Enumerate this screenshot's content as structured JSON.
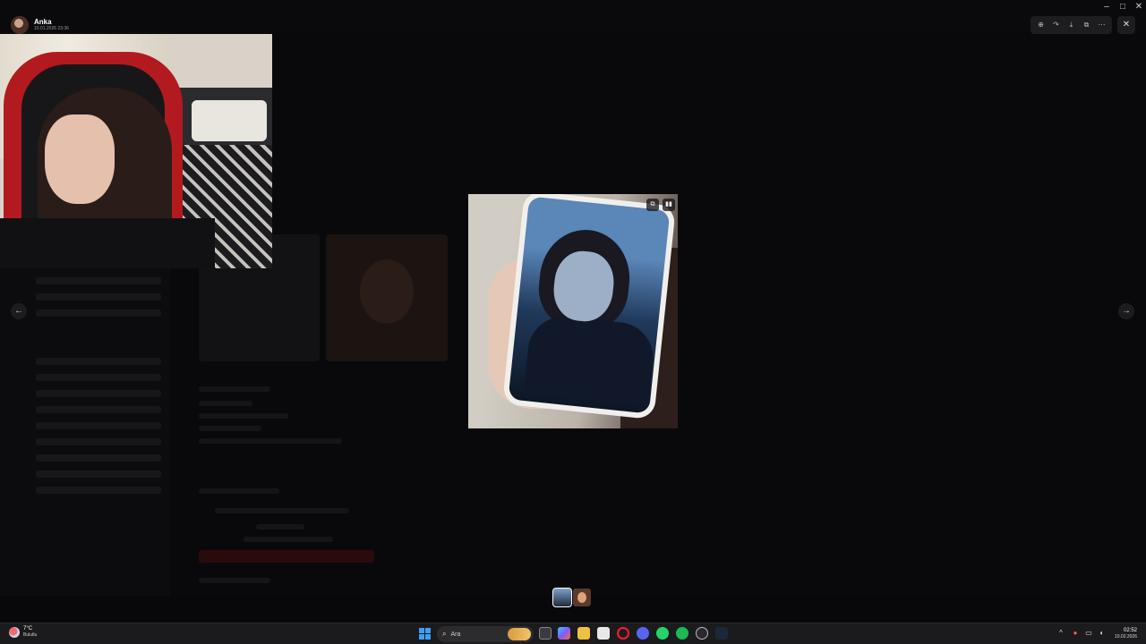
{
  "uploader": {
    "name": "Anka",
    "date": "10.01.2026 23:36"
  },
  "viewer_toolbar": {
    "icons": [
      "zoom-in-icon",
      "forward-icon",
      "download-icon",
      "open-external-icon",
      "more-icon"
    ],
    "close_glyph": "✕"
  },
  "navigation": {
    "prev_glyph": "←",
    "next_glyph": "→"
  },
  "media_buttons": {
    "open_original_glyph": "⧉",
    "gif_glyph": "▮▮"
  },
  "taskbar": {
    "weather_temp": "7°C",
    "weather_condition": "Bulutlu",
    "search_placeholder": "Ara",
    "clock_time": "02:52",
    "clock_date": "10.02.2026"
  },
  "colors": {
    "accent_blue": "#3aa0ff",
    "chair_red": "#b31a1f",
    "taskbar_bg": "#1b1b1d"
  }
}
